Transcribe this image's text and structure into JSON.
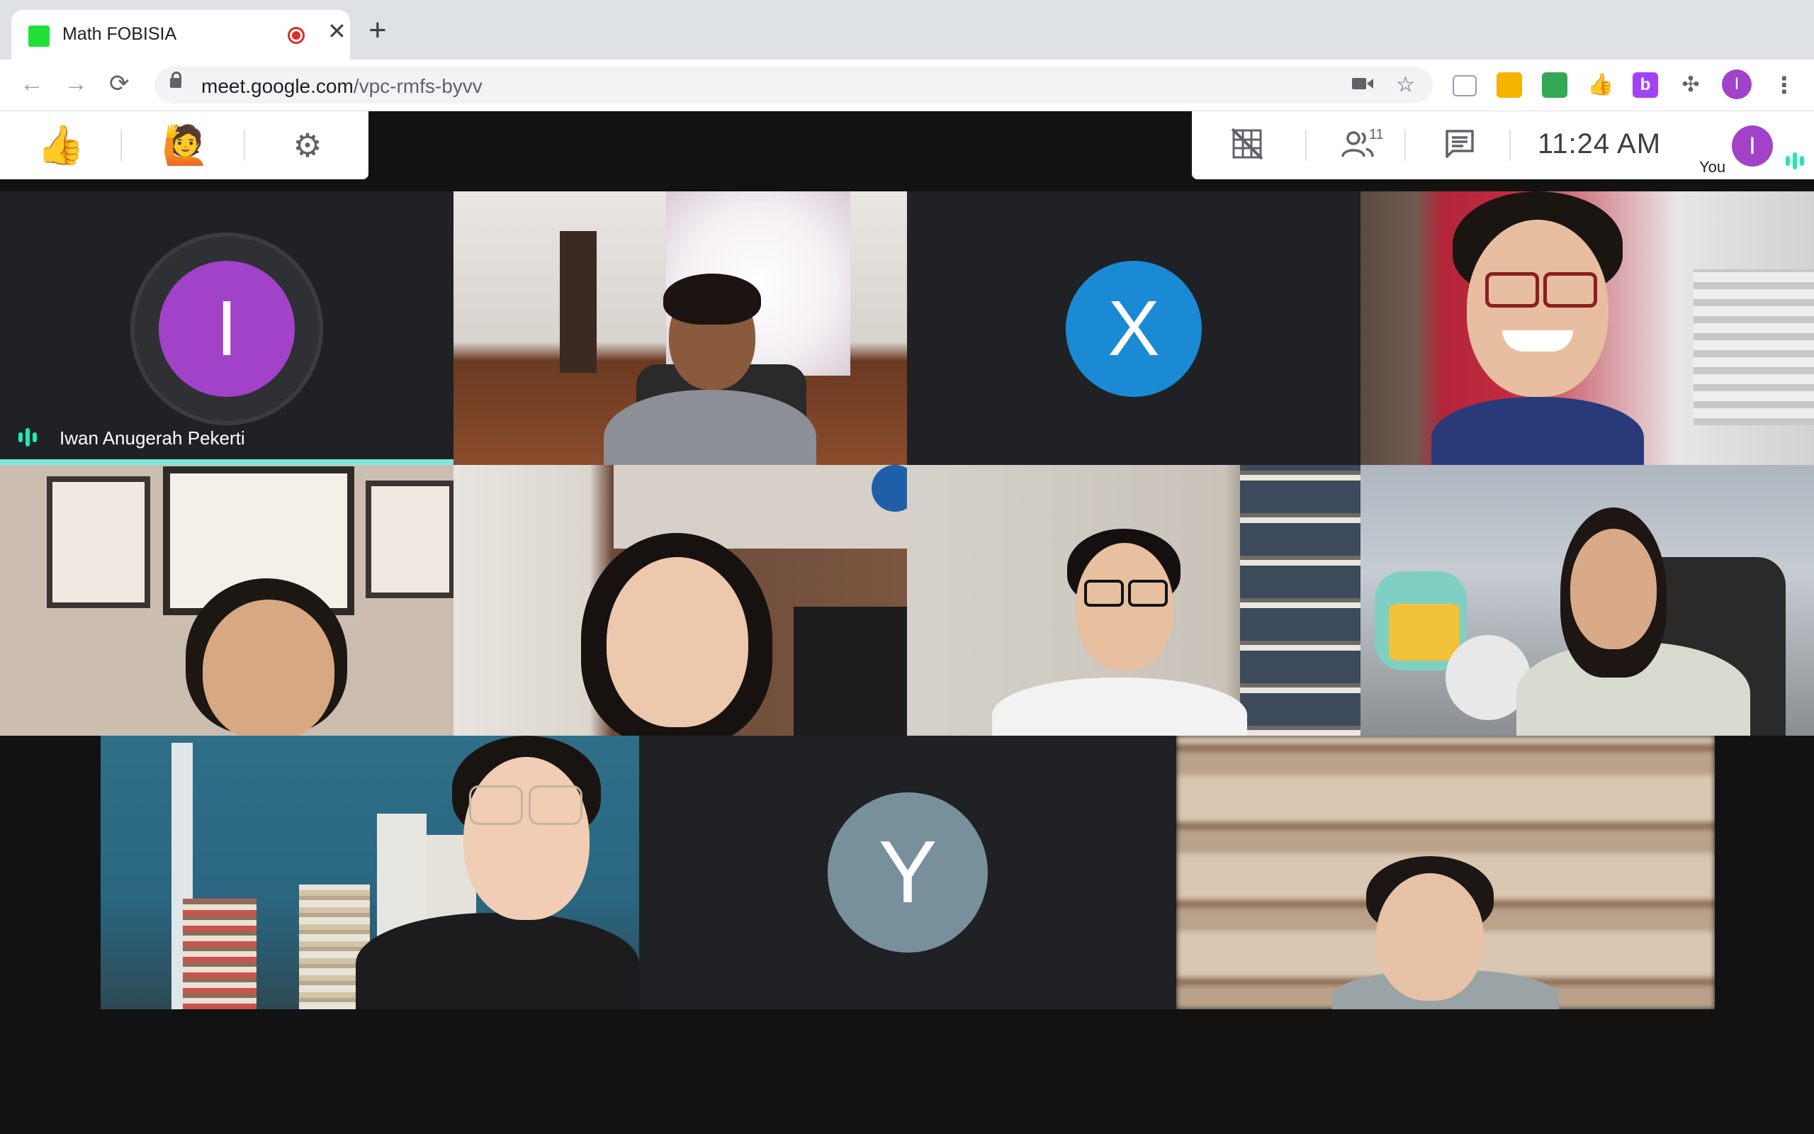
{
  "browser": {
    "tab_title": "Math FOBISIA",
    "tab_close": "✕",
    "new_tab": "+",
    "url_host": "meet.google.com",
    "url_path": "/vpc-rmfs-byvv",
    "profile_initial": "I",
    "colors": {
      "favicon": "#22e03a",
      "recording": "#d93025",
      "profile": "#a142c8"
    }
  },
  "meet": {
    "left_toolbar": {
      "thumbs_up": "👍",
      "raise_hand": "🙋"
    },
    "right_toolbar": {
      "participant_count": "11",
      "time": "11:24 AM",
      "you_label": "You",
      "you_initial": "I"
    },
    "accent": "#1de9b6",
    "participants": [
      {
        "type": "avatar",
        "initial": "I",
        "name": "Iwan Anugerah Pekerti",
        "color": "#a142c8",
        "speaking": true
      },
      {
        "type": "video"
      },
      {
        "type": "avatar",
        "initial": "X",
        "color": "#1a8ad4"
      },
      {
        "type": "video"
      },
      {
        "type": "video"
      },
      {
        "type": "video"
      },
      {
        "type": "video"
      },
      {
        "type": "video"
      },
      {
        "type": "video"
      },
      {
        "type": "avatar",
        "initial": "Y",
        "color": "#78909c"
      },
      {
        "type": "video"
      }
    ]
  }
}
